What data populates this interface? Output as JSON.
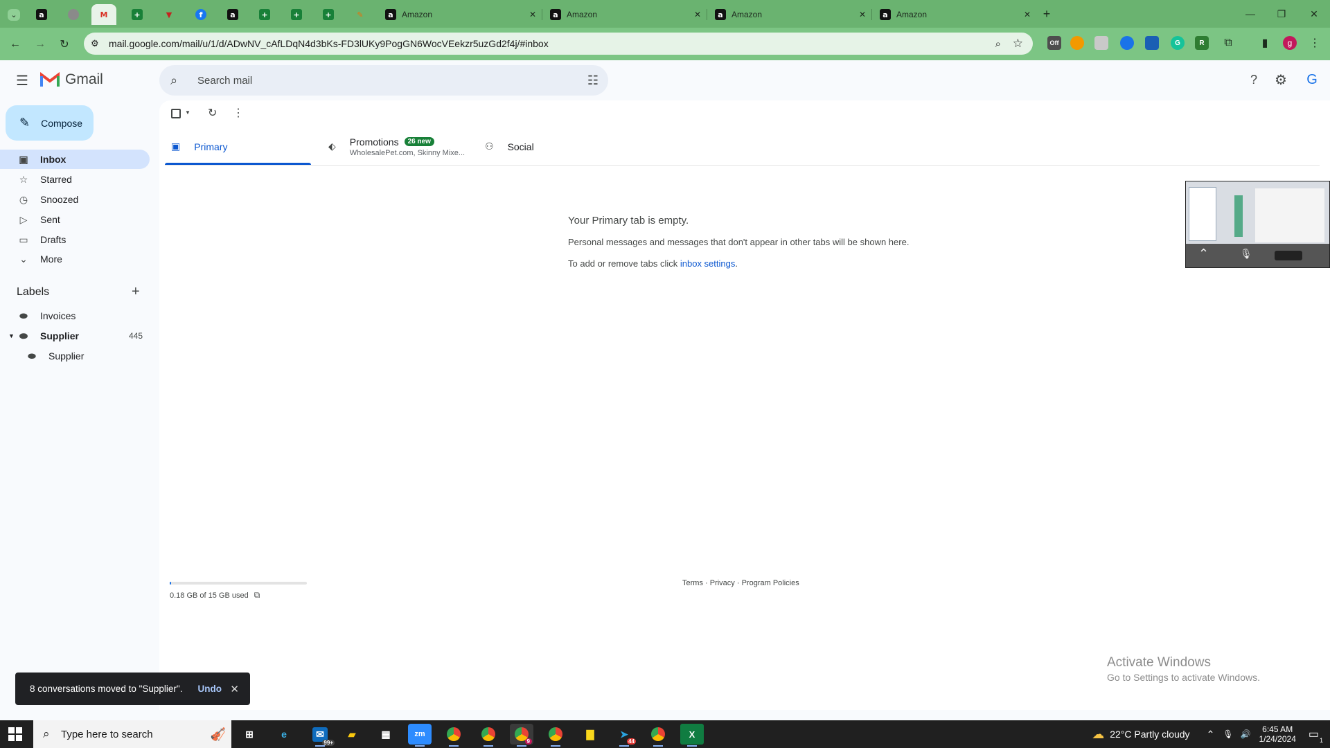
{
  "browser": {
    "tabs": [
      {
        "title": "Amazon"
      },
      {
        "title": "Amazon"
      },
      {
        "title": "Amazon"
      },
      {
        "title": "Amazon"
      }
    ],
    "new_tab": "+",
    "url": "mail.google.com/mail/u/1/d/ADwNV_cAfLDqN4d3bKs-FD3lUKy9PogGN6WocVEekzr5uzGd2f4j/#inbox",
    "profile_initial": "g",
    "ext_badge": "Off"
  },
  "gmail": {
    "app_name": "Gmail",
    "search_placeholder": "Search mail",
    "compose": "Compose",
    "nav": [
      {
        "label": "Inbox"
      },
      {
        "label": "Starred"
      },
      {
        "label": "Snoozed"
      },
      {
        "label": "Sent"
      },
      {
        "label": "Drafts"
      },
      {
        "label": "More"
      }
    ],
    "labels_heading": "Labels",
    "labels": [
      {
        "label": "Invoices",
        "count": ""
      },
      {
        "label": "Supplier",
        "count": "445"
      },
      {
        "label": "Supplier",
        "count": ""
      }
    ],
    "tabs": {
      "primary": "Primary",
      "promotions": "Promotions",
      "promotions_badge": "26 new",
      "promotions_sub": "WholesalePet.com, Skinny Mixe...",
      "social": "Social"
    },
    "empty": {
      "title": "Your Primary tab is empty.",
      "line1": "Personal messages and messages that don't appear in other tabs will be shown here.",
      "line2_prefix": "To add or remove tabs click ",
      "line2_link": "inbox settings",
      "line2_suffix": "."
    },
    "storage": {
      "text": "0.18 GB of 15 GB used",
      "fraction": 0.012
    },
    "footer": {
      "terms": "Terms",
      "privacy": "Privacy",
      "policies": "Program Policies",
      "dot": " · "
    },
    "snackbar": {
      "text": "8 conversations moved to \"Supplier\".",
      "undo": "Undo"
    }
  },
  "watermark": {
    "line1": "Activate Windows",
    "line2": "Go to Settings to activate Windows."
  },
  "taskbar": {
    "search_placeholder": "Type here to search",
    "weather": "22°C  Partly cloudy",
    "time": "6:45 AM",
    "date": "1/24/2024",
    "mail_badge": "99+",
    "chrome_badge": "9",
    "telegram_badge": "44",
    "notif_count": "1"
  },
  "colors": {
    "tabstrip": "#6ab370",
    "toolbar": "#7cc584",
    "accent": "#0b57d0",
    "compose": "#c2e7ff",
    "badge": "#188038"
  }
}
